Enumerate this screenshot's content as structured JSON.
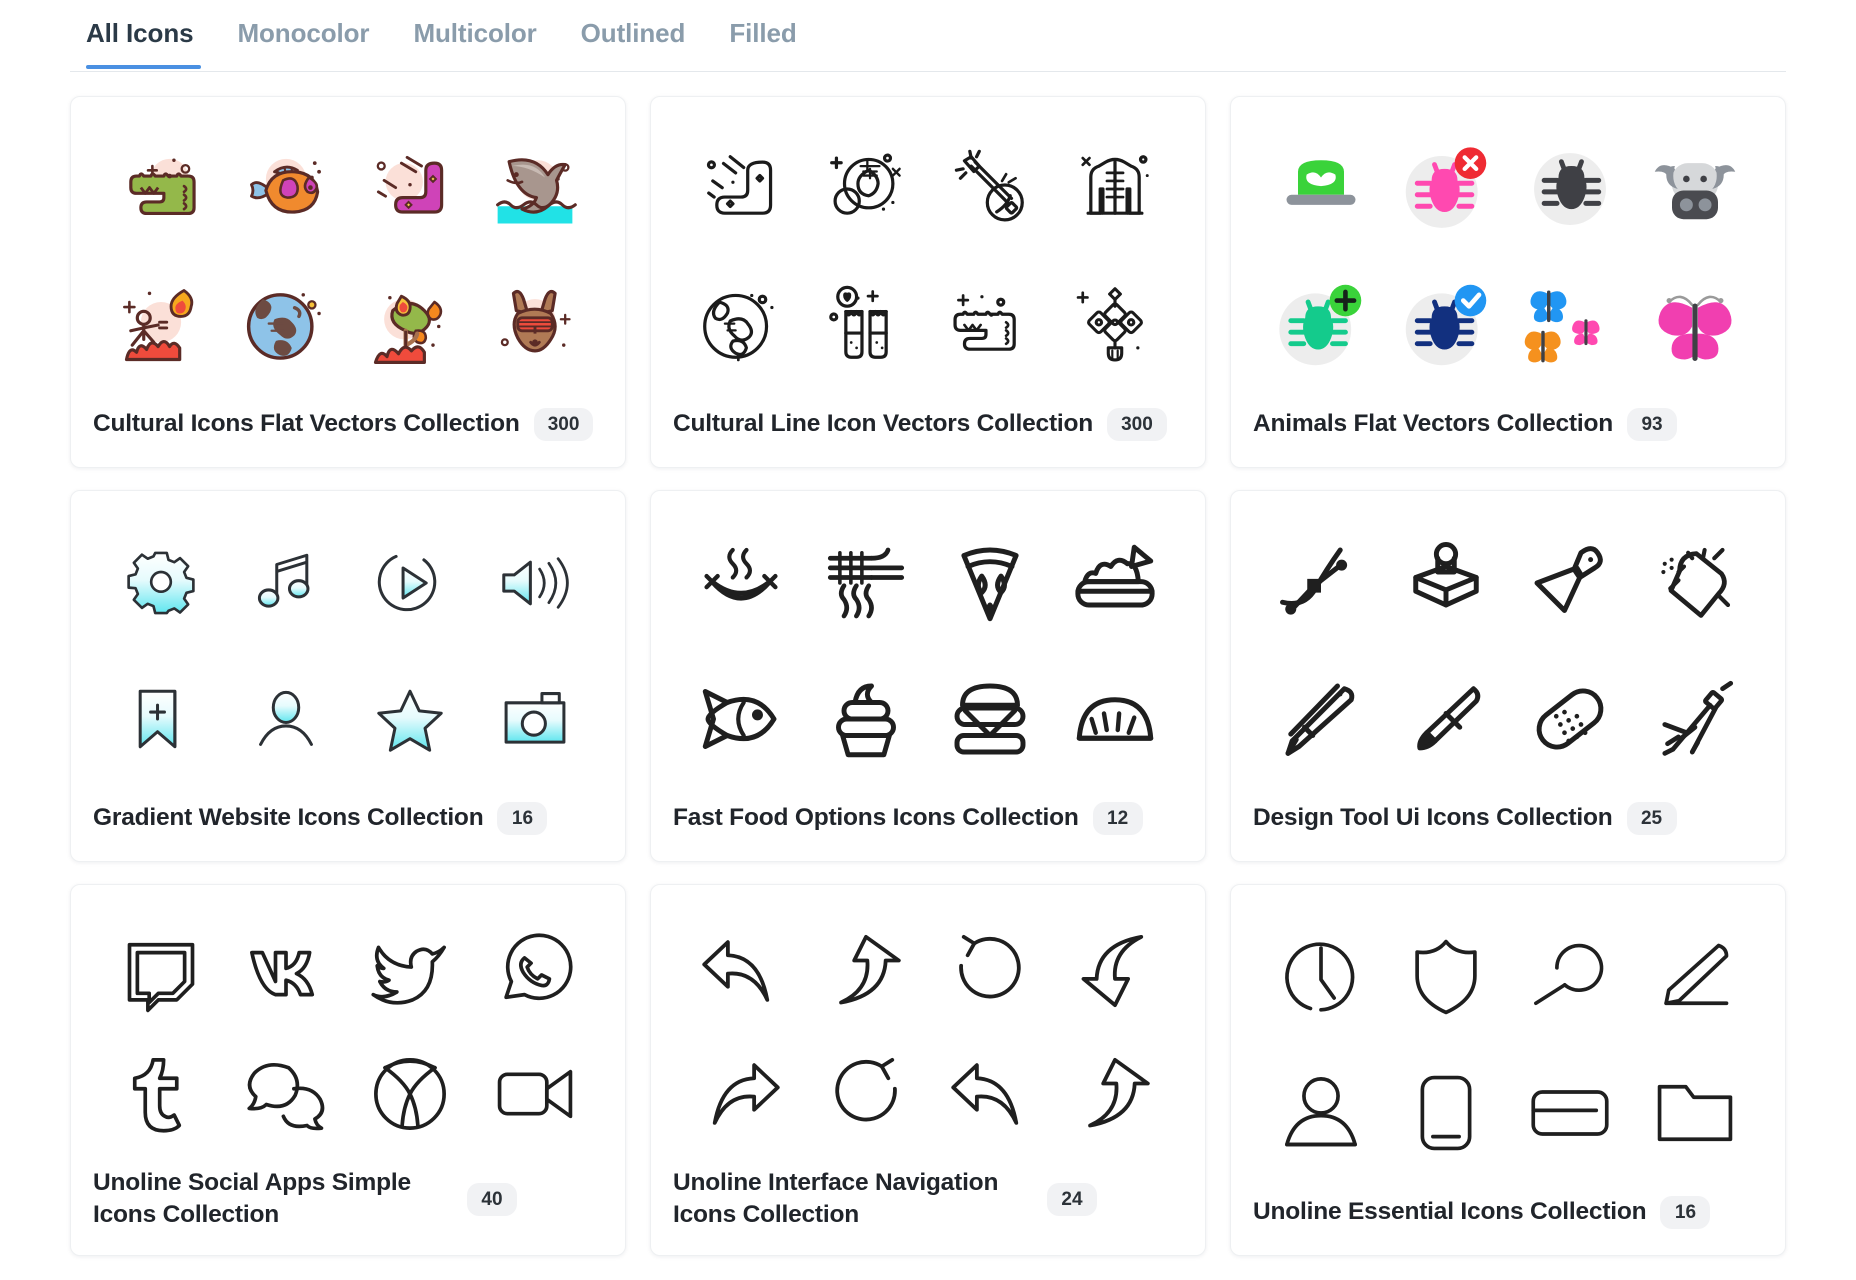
{
  "tabs": [
    {
      "label": "All Icons",
      "active": true
    },
    {
      "label": "Monocolor",
      "active": false
    },
    {
      "label": "Multicolor",
      "active": false
    },
    {
      "label": "Outlined",
      "active": false
    },
    {
      "label": "Filled",
      "active": false
    }
  ],
  "accent_color": "#4a90e2",
  "active_tab_color": "#2b3a47",
  "inactive_tab_color": "#8a9cab",
  "badge_bg": "#f1f2f4",
  "cards": [
    {
      "title": "Cultural Icons Flat Vectors Collection",
      "count": "300",
      "style": "flat-color",
      "icons": [
        "crocodile-icon",
        "tropical-fish-icon",
        "boomerang-icon",
        "dolphin-icon",
        "fire-dancer-icon",
        "globe-australia-icon",
        "burning-tree-icon",
        "kangaroo-icon"
      ]
    },
    {
      "title": "Cultural Line Icon Vectors Collection",
      "count": "300",
      "style": "line",
      "icons": [
        "boomerang-line-icon",
        "chinese-coin-icon",
        "banjo-icon",
        "mandarin-jacket-icon",
        "globe-line-icon",
        "beer-glasses-icon",
        "crocodile-line-icon",
        "chinese-knot-icon"
      ]
    },
    {
      "title": "Animals Flat Vectors Collection",
      "count": "93",
      "style": "flat-solid",
      "icons": [
        "green-beetle-shell-icon",
        "pink-bug-error-icon",
        "dark-bug-icon",
        "bull-head-icon",
        "green-bug-add-icon",
        "blue-bug-check-icon",
        "three-butterflies-icon",
        "pink-butterfly-icon"
      ]
    },
    {
      "title": "Gradient Website Icons Collection",
      "count": "16",
      "style": "gradient-line",
      "icons": [
        "gear-icon",
        "music-note-icon",
        "play-circle-icon",
        "speaker-volume-icon",
        "bookmark-add-icon",
        "user-avatar-icon",
        "star-icon",
        "camera-icon"
      ]
    },
    {
      "title": "Fast Food Options Icons Collection",
      "count": "12",
      "style": "bold-line",
      "icons": [
        "sausage-icon",
        "noodles-fork-icon",
        "pizza-slice-icon",
        "rice-bowl-icon",
        "fish-icon",
        "ice-cream-cup-icon",
        "burger-icon",
        "dumpling-icon"
      ]
    },
    {
      "title": "Design Tool Ui Icons Collection",
      "count": "25",
      "style": "bold-line",
      "icons": [
        "bezier-curve-icon",
        "stamp-tool-icon",
        "scraper-tool-icon",
        "spray-can-icon",
        "pen-tool-icon",
        "marker-pen-icon",
        "eraser-icon",
        "compass-tool-icon"
      ]
    },
    {
      "title": "Unoline Social Apps Simple Icons Collection",
      "count": "40",
      "style": "line",
      "two_line": true,
      "icons": [
        "twitch-icon",
        "vk-icon",
        "twitter-icon",
        "whatsapp-icon",
        "tumblr-icon",
        "chat-bubbles-icon",
        "xbox-icon",
        "video-camera-icon"
      ]
    },
    {
      "title": "Unoline Interface Navigation Icons Collection",
      "count": "24",
      "style": "line",
      "two_line": true,
      "icons": [
        "reply-left-arrow-icon",
        "share-up-arrow-icon",
        "undo-arrow-icon",
        "download-curve-arrow-icon",
        "forward-right-arrow-icon",
        "redo-arrow-icon",
        "reply-left-arrow-2-icon",
        "share-up-arrow-2-icon"
      ]
    },
    {
      "title": "Unoline Essential Icons Collection",
      "count": "16",
      "style": "line",
      "icons": [
        "clock-icon",
        "shield-icon",
        "search-icon",
        "pencil-edit-icon",
        "user-icon",
        "mobile-phone-icon",
        "credit-card-icon",
        "folder-icon"
      ]
    }
  ]
}
